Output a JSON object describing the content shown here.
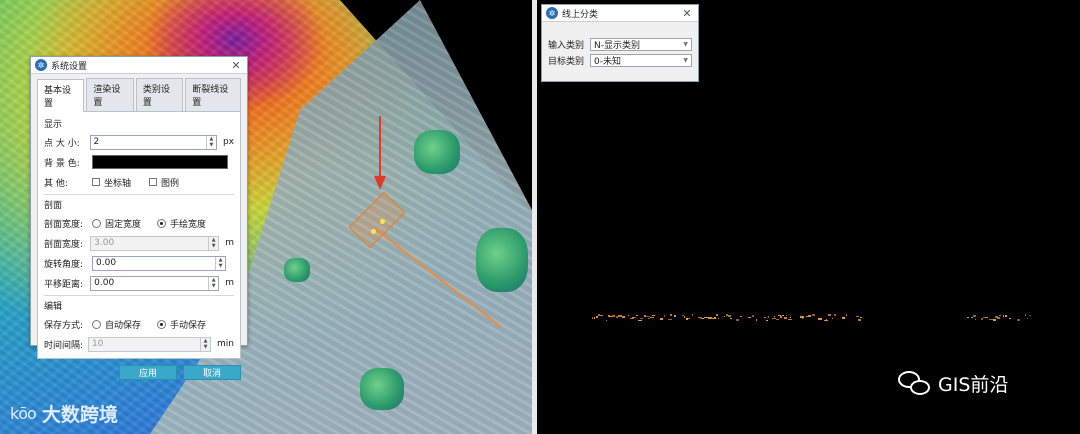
{
  "left_dialog": {
    "title": "系统设置",
    "tabs": [
      {
        "label": "基本设置"
      },
      {
        "label": "渲染设置"
      },
      {
        "label": "类别设置"
      },
      {
        "label": "断裂线设置"
      }
    ],
    "display": {
      "group": "显示",
      "point_size_label": "点 大 小:",
      "point_size_value": "2",
      "point_size_unit": "px",
      "bg_color_label": "背 景 色:",
      "bg_color": "#000000",
      "other_label": "其    他:",
      "axis_label": "坐标轴",
      "legend_label": "图例"
    },
    "profile": {
      "group": "剖面",
      "width_mode_label": "剖面宽度:",
      "fixed_width_label": "固定宽度",
      "manual_width_label": "手绘宽度",
      "width_label": "剖面宽度:",
      "width_value": "3.00",
      "width_unit": "m",
      "rotation_label": "旋转角度:",
      "rotation_value": "0.00",
      "offset_label": "平移距离:",
      "offset_value": "0.00",
      "offset_unit": "m"
    },
    "edit": {
      "group": "编辑",
      "save_mode_label": "保存方式:",
      "auto_save_label": "自动保存",
      "manual_save_label": "手动保存",
      "interval_label": "时间间隔:",
      "interval_value": "10",
      "interval_unit": "min"
    },
    "apply_label": "应用",
    "cancel_label": "取消"
  },
  "right_dialog": {
    "title": "线上分类",
    "input_class_label": "输入类别",
    "input_class_value": "N-显示类别",
    "target_class_label": "目标类别",
    "target_class_value": "0-未知"
  },
  "watermark_left": {
    "logo": "kōo",
    "text": "大数跨境"
  },
  "watermark_right": {
    "text": "GIS前沿"
  },
  "colors": {
    "accent_button": "#3aa8c8",
    "point_cloud": "#f0a040",
    "arrow": "#e03a2a"
  }
}
